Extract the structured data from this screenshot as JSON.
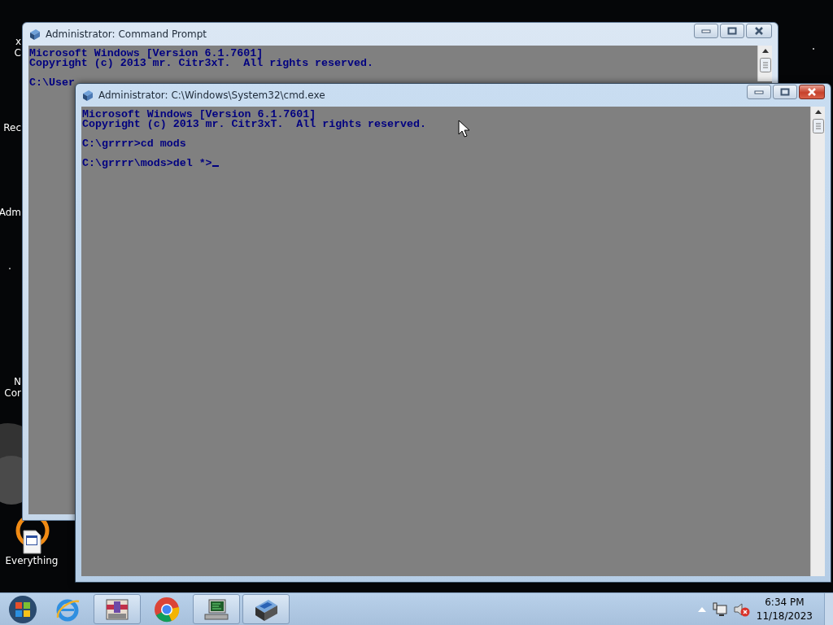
{
  "desktop": {
    "icons": [
      {
        "lines": [
          "x",
          "C"
        ]
      },
      {
        "lines": [
          "Rec"
        ]
      },
      {
        "lines": [
          "Adm"
        ]
      },
      {
        "lines": [
          "N",
          "Cor"
        ]
      },
      {
        "lines": [
          "Everything"
        ]
      }
    ]
  },
  "windows": [
    {
      "title": "Administrator: Command Prompt",
      "active": false,
      "cursor": false,
      "paragraphs": [
        [
          "Microsoft Windows [Version 6.1.7601]",
          "Copyright (c) 2013 mr. Citr3xT.  All rights reserved."
        ],
        [
          "C:\\User"
        ]
      ]
    },
    {
      "title": "Administrator: C:\\Windows\\System32\\cmd.exe",
      "active": true,
      "cursor": true,
      "paragraphs": [
        [
          "Microsoft Windows [Version 6.1.7601]",
          "Copyright (c) 2013 mr. Citr3xT.  All rights reserved."
        ],
        [
          "C:\\grrrr>cd mods"
        ],
        [
          "C:\\grrrr\\mods>del *>"
        ]
      ]
    }
  ],
  "taskbar": {
    "items": [
      {
        "kind": "browser",
        "running": false
      },
      {
        "kind": "archive",
        "running": true
      },
      {
        "kind": "chrome",
        "running": false
      },
      {
        "kind": "monitor",
        "running": true
      },
      {
        "kind": "console",
        "running": true
      }
    ],
    "tray": {
      "volume_muted": true,
      "time": "6:34 PM",
      "date": "11/18/2023"
    }
  }
}
